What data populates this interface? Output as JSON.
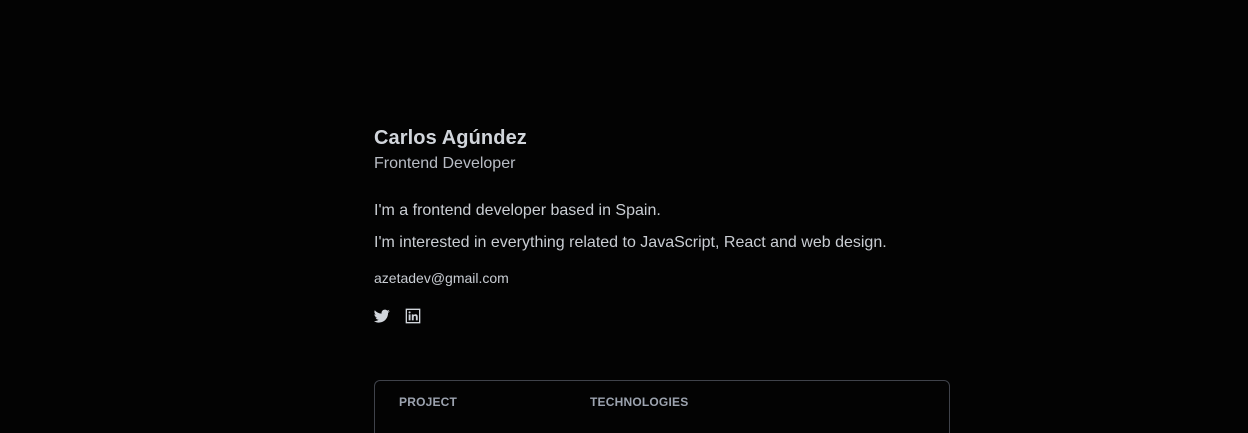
{
  "profile": {
    "name": "Carlos Agúndez",
    "role": "Frontend Developer",
    "bio": [
      "I'm a frontend developer based in Spain.",
      "I'm interested in everything related to JavaScript, React and web design."
    ],
    "email": "azetadev@gmail.com"
  },
  "socials": [
    {
      "icon": "twitter-icon"
    },
    {
      "icon": "linkedin-icon"
    }
  ],
  "projects_table": {
    "columns": [
      "PROJECT",
      "TECHNOLOGIES"
    ]
  },
  "colors": {
    "background": "#030303",
    "text": "#d1d5db",
    "border": "#3f424a",
    "header_text": "#9ca3af"
  }
}
